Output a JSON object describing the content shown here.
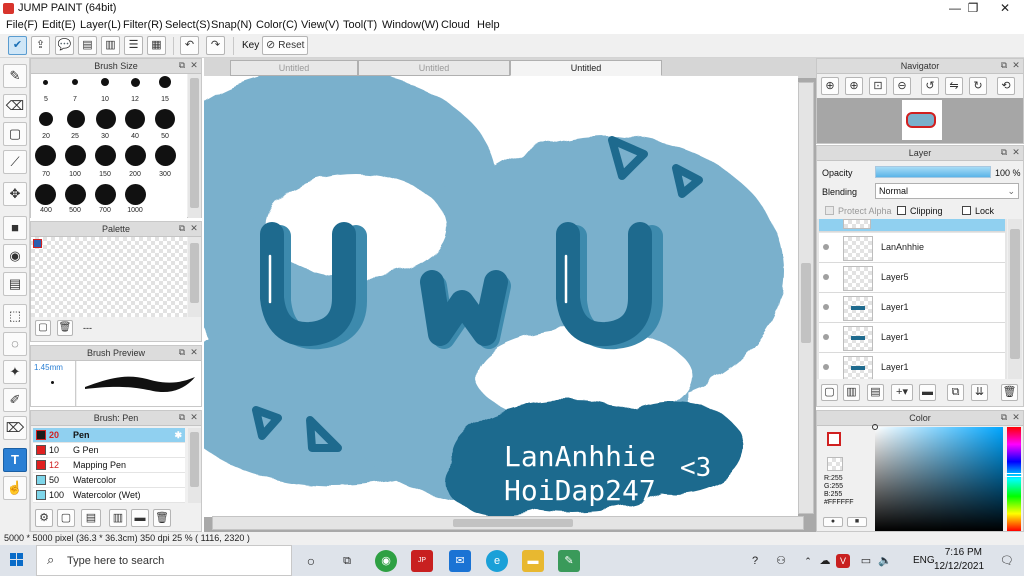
{
  "app": {
    "title": "JUMP PAINT (64bit)"
  },
  "menu": [
    "File(F)",
    "Edit(E)",
    "Layer(L)",
    "Filter(R)",
    "Select(S)",
    "Snap(N)",
    "Color(C)",
    "View(V)",
    "Tool(T)",
    "Window(W)",
    "Cloud",
    "Help"
  ],
  "toolbar": {
    "key_label": "Key",
    "reset_label": "Reset"
  },
  "brush_size": {
    "title": "Brush Size",
    "sizes": [
      "5",
      "7",
      "10",
      "12",
      "15",
      "20",
      "25",
      "30",
      "40",
      "50",
      "70",
      "100",
      "150",
      "200",
      "300",
      "400",
      "500",
      "700",
      "1000"
    ]
  },
  "palette": {
    "title": "Palette",
    "footer_text": "---"
  },
  "brush_preview": {
    "title": "Brush Preview",
    "size_label": "1.45mm"
  },
  "brush_list": {
    "title": "Brush: Pen",
    "items": [
      {
        "size": "20",
        "name": "Pen",
        "color": "#e02020"
      },
      {
        "size": "10",
        "name": "G Pen",
        "color": "#e02020"
      },
      {
        "size": "12",
        "name": "Mapping Pen",
        "color": "#e02020"
      },
      {
        "size": "50",
        "name": "Watercolor",
        "color": "#7fd6ea"
      },
      {
        "size": "100",
        "name": "Watercolor (Wet)",
        "color": "#7fd6ea"
      }
    ]
  },
  "tabs": [
    "Untitled",
    "Untitled",
    "Untitled"
  ],
  "artwork": {
    "word": "UwU",
    "signature_line1": "LanAnhhie",
    "signature_line2": "HoiDap247",
    "heart": "<3"
  },
  "navigator": {
    "title": "Navigator"
  },
  "layer_panel": {
    "title": "Layer",
    "opacity_label": "Opacity",
    "opacity_value": "100 %",
    "opacity_percent": 100,
    "blending_label": "Blending",
    "blending_value": "Normal",
    "protect_alpha_label": "Protect Alpha",
    "clipping_label": "Clipping",
    "lock_label": "Lock",
    "layers": [
      "LanAnhhie",
      "Layer5",
      "Layer1",
      "Layer1",
      "Layer1"
    ]
  },
  "color_panel": {
    "title": "Color",
    "r": "R:255",
    "g": "G:255",
    "b": "B:255",
    "hex": "#FFFFFF"
  },
  "status": {
    "text": "5000 * 5000 pixel   (36.3 * 36.3cm)   350 dpi   25 %   ( 1116, 2320 )"
  },
  "taskbar": {
    "search_placeholder": "Type here to search",
    "lang": "ENG",
    "time": "7:16 PM",
    "date": "12/12/2021"
  },
  "colors": {
    "accent": "#1e6a8e",
    "cloud": "#7ab0cc",
    "highlight": "#90d0f0"
  }
}
